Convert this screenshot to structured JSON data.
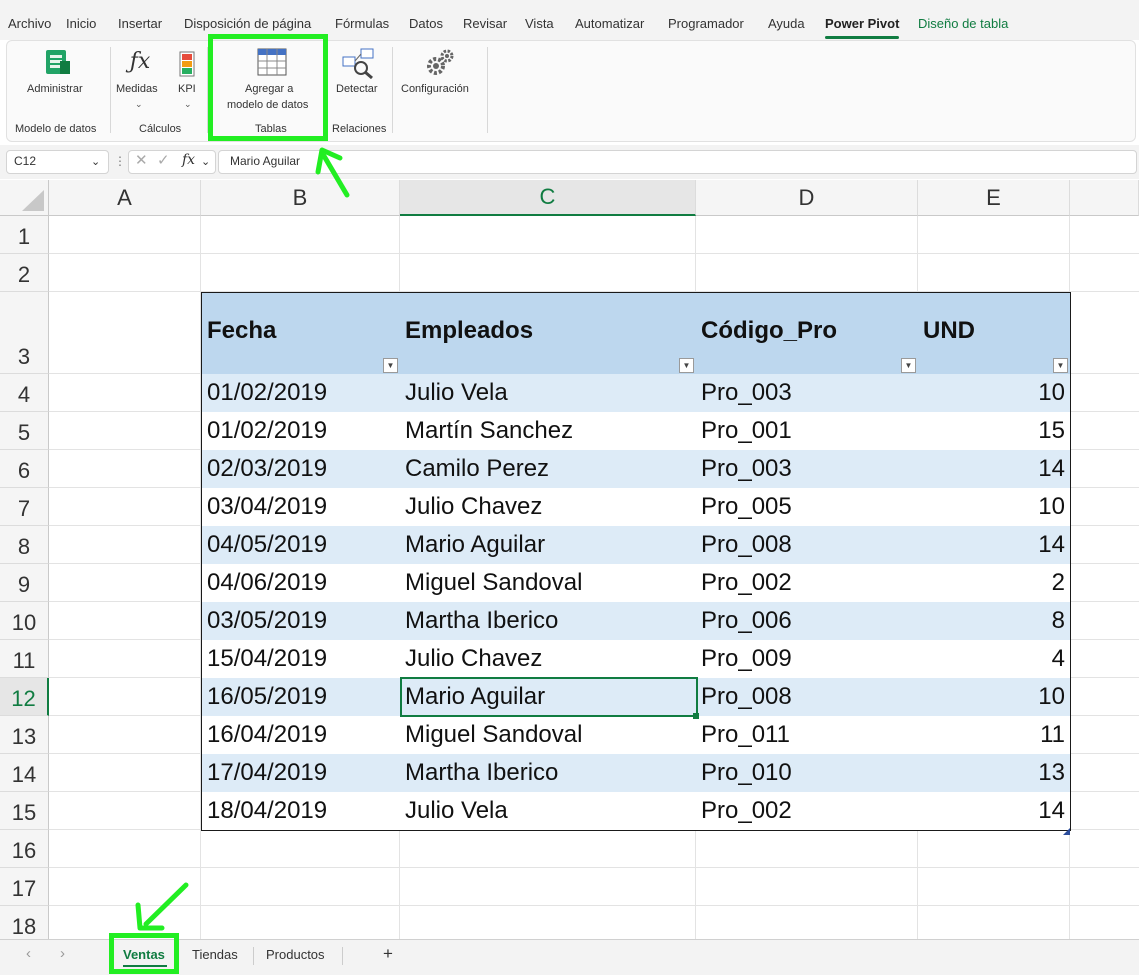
{
  "menu": {
    "items": [
      "Archivo",
      "Inicio",
      "Insertar",
      "Disposición de página",
      "Fórmulas",
      "Datos",
      "Revisar",
      "Vista",
      "Automatizar",
      "Programador",
      "Ayuda",
      "Power Pivot",
      "Diseño de tabla"
    ],
    "active": "Power Pivot"
  },
  "ribbon": {
    "administrar": "Administrar",
    "medidas": "Medidas",
    "kpi": "KPI",
    "agregar_line1": "Agregar a",
    "agregar_line2": "modelo de datos",
    "detectar": "Detectar",
    "configuracion": "Configuración",
    "groups": {
      "modelo": "Modelo de datos",
      "calculos": "Cálculos",
      "tablas": "Tablas",
      "relaciones": "Relaciones"
    }
  },
  "formula_bar": {
    "name_box": "C12",
    "fx": "fx",
    "content": "Mario Aguilar"
  },
  "grid": {
    "columns": [
      "A",
      "B",
      "C",
      "D",
      "E"
    ],
    "selected_column": "C",
    "rows": [
      "1",
      "2",
      "3",
      "4",
      "5",
      "6",
      "7",
      "8",
      "9",
      "10",
      "11",
      "12",
      "13",
      "14",
      "15",
      "16",
      "17",
      "18"
    ],
    "selected_row": "12"
  },
  "table": {
    "headers": [
      "Fecha",
      "Empleados",
      "Código_Pro",
      "UND"
    ],
    "rows": [
      [
        "01/02/2019",
        "Julio Vela",
        "Pro_003",
        "10"
      ],
      [
        "01/02/2019",
        "Martín Sanchez",
        "Pro_001",
        "15"
      ],
      [
        "02/03/2019",
        "Camilo Perez",
        "Pro_003",
        "14"
      ],
      [
        "03/04/2019",
        "Julio Chavez",
        "Pro_005",
        "10"
      ],
      [
        "04/05/2019",
        "Mario Aguilar",
        "Pro_008",
        "14"
      ],
      [
        "04/06/2019",
        "Miguel Sandoval",
        "Pro_002",
        "2"
      ],
      [
        "03/05/2019",
        "Martha Iberico",
        "Pro_006",
        "8"
      ],
      [
        "15/04/2019",
        "Julio Chavez",
        "Pro_009",
        "4"
      ],
      [
        "16/05/2019",
        "Mario Aguilar",
        "Pro_008",
        "10"
      ],
      [
        "16/04/2019",
        "Miguel Sandoval",
        "Pro_011",
        "11"
      ],
      [
        "17/04/2019",
        "Martha Iberico",
        "Pro_010",
        "13"
      ],
      [
        "18/04/2019",
        "Julio Vela",
        "Pro_002",
        "14"
      ]
    ]
  },
  "sheets": {
    "tabs": [
      "Ventas",
      "Tiendas",
      "Productos"
    ],
    "active": "Ventas",
    "add": "+"
  },
  "colors": {
    "accent": "#107c41",
    "header_fill": "#bdd7ee",
    "band_fill": "#ddebf7",
    "highlight": "#22ee22"
  }
}
